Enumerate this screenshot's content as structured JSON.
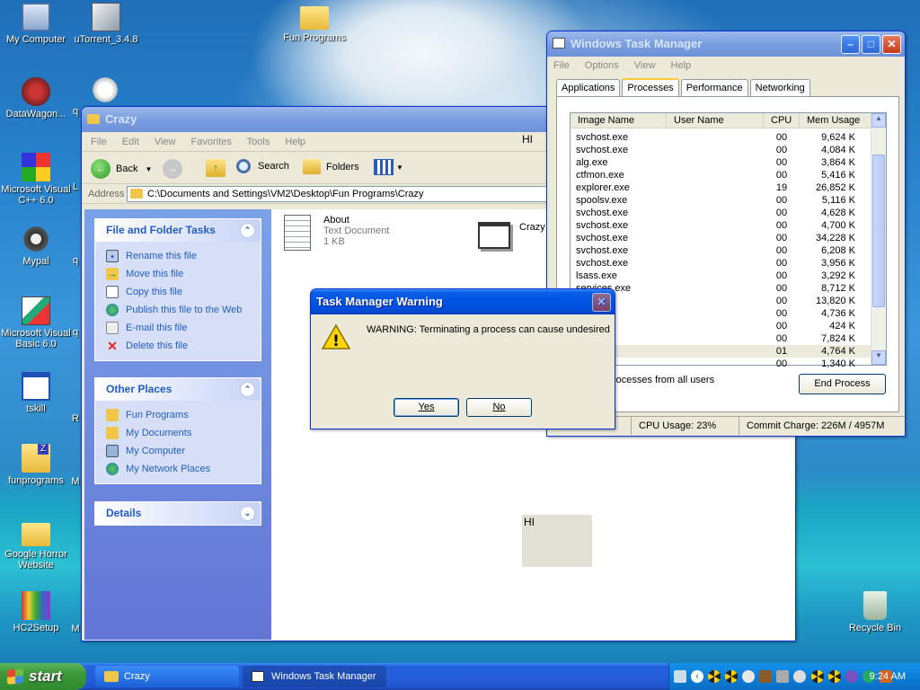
{
  "desktop": {
    "icons": [
      {
        "label": "My Computer"
      },
      {
        "label": "uTorrent_3.4.8"
      },
      {
        "label": "Fun Programs"
      },
      {
        "label": "DataWagon..."
      },
      {
        "label": "Microsoft Visual C++ 6.0"
      },
      {
        "label": "Mypal"
      },
      {
        "label": "Microsoft Visual Basic 6.0"
      },
      {
        "label": "tskill"
      },
      {
        "label": "funprograms"
      },
      {
        "label": "Google Horror Website"
      },
      {
        "label": "HC2Setup"
      },
      {
        "label": "Recycle Bin"
      }
    ],
    "partial_labels": [
      "q",
      "L",
      "q",
      "q",
      "R",
      "M",
      "M"
    ]
  },
  "explorer": {
    "title": "Crazy",
    "menu": [
      "File",
      "Edit",
      "View",
      "Favorites",
      "Tools",
      "Help"
    ],
    "menu_extra": "HI",
    "toolbar": {
      "back": "Back",
      "search": "Search",
      "folders": "Folders"
    },
    "address_label": "Address",
    "address_value": "C:\\Documents and Settings\\VM2\\Desktop\\Fun Programs\\Crazy",
    "file_tasks": {
      "title": "File and Folder Tasks",
      "items": [
        "Rename this file",
        "Move this file",
        "Copy this file",
        "Publish this file to the Web",
        "E-mail this file",
        "Delete this file"
      ]
    },
    "other_places": {
      "title": "Other Places",
      "items": [
        "Fun Programs",
        "My Documents",
        "My Computer",
        "My Network Places"
      ]
    },
    "details": {
      "title": "Details"
    },
    "files": [
      {
        "name": "About",
        "type": "Text Document",
        "size": "1 KB"
      },
      {
        "name": "Crazy"
      }
    ],
    "hi_box": "HI"
  },
  "taskmgr": {
    "title": "Windows Task Manager",
    "menu": [
      "File",
      "Options",
      "View",
      "Help"
    ],
    "tabs": [
      "Applications",
      "Processes",
      "Performance",
      "Networking"
    ],
    "columns": [
      "Image Name",
      "User Name",
      "CPU",
      "Mem Usage"
    ],
    "rows": [
      [
        "svchost.exe",
        "",
        "00",
        "9,624 K"
      ],
      [
        "svchost.exe",
        "",
        "00",
        "4,084 K"
      ],
      [
        "alg.exe",
        "",
        "00",
        "3,864 K"
      ],
      [
        "ctfmon.exe",
        "",
        "00",
        "5,416 K"
      ],
      [
        "explorer.exe",
        "",
        "19",
        "26,852 K"
      ],
      [
        "spoolsv.exe",
        "",
        "00",
        "5,116 K"
      ],
      [
        "svchost.exe",
        "",
        "00",
        "4,628 K"
      ],
      [
        "svchost.exe",
        "",
        "00",
        "4,700 K"
      ],
      [
        "svchost.exe",
        "",
        "00",
        "34,228 K"
      ],
      [
        "svchost.exe",
        "",
        "00",
        "6,208 K"
      ],
      [
        "svchost.exe",
        "",
        "00",
        "3,956 K"
      ],
      [
        "lsass.exe",
        "",
        "00",
        "3,292 K"
      ],
      [
        "services.exe",
        "",
        "00",
        "8,712 K"
      ],
      [
        ".exe",
        "",
        "00",
        "13,820 K"
      ],
      [
        "",
        "",
        "00",
        "4,736 K"
      ],
      [
        "",
        "",
        "00",
        "424 K"
      ],
      [
        "e",
        "",
        "00",
        "7,824 K"
      ],
      [
        "e",
        "",
        "01",
        "4,764 K"
      ],
      [
        ".exe",
        "",
        "00",
        "1,340 K"
      ]
    ],
    "show_all": "rocesses from all users",
    "end_process": "End Process",
    "status": {
      "cpu": "CPU Usage: 23%",
      "commit": "Commit Charge: 226M / 4957M"
    }
  },
  "warning": {
    "title": "Task Manager Warning",
    "message": "WARNING: Terminating a process can cause undesired",
    "yes": "Yes",
    "no": "No"
  },
  "taskbar": {
    "start": "start",
    "buttons": [
      "Crazy",
      "Windows Task Manager"
    ],
    "clock": "9:24 AM"
  }
}
